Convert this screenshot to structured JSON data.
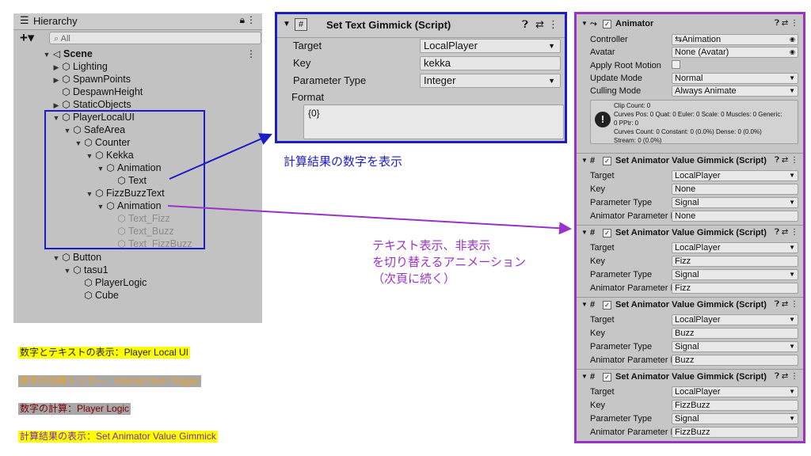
{
  "hierarchy": {
    "title": "Hierarchy",
    "search_placeholder": "All",
    "items": [
      {
        "label": "Scene"
      },
      {
        "label": "Lighting"
      },
      {
        "label": "SpawnPoints"
      },
      {
        "label": "DespawnHeight"
      },
      {
        "label": "StaticObjects"
      },
      {
        "label": "PlayerLocalUI"
      },
      {
        "label": "SafeArea"
      },
      {
        "label": "Counter"
      },
      {
        "label": "Kekka"
      },
      {
        "label": "Animation"
      },
      {
        "label": "Text"
      },
      {
        "label": "FizzBuzzText"
      },
      {
        "label": "Animation"
      },
      {
        "label": "Text_Fizz"
      },
      {
        "label": "Text_Buzz"
      },
      {
        "label": "Text_FizzBuzz"
      },
      {
        "label": "Button"
      },
      {
        "label": "tasu1"
      },
      {
        "label": "PlayerLogic"
      },
      {
        "label": "Cube"
      }
    ]
  },
  "inspector": {
    "title": "Set Text Gimmick (Script)",
    "fields": [
      {
        "label": "Target",
        "value": "LocalPlayer"
      },
      {
        "label": "Key",
        "value": "kekka"
      },
      {
        "label": "Parameter Type",
        "value": "Integer"
      }
    ],
    "format_label": "Format",
    "format_value": "{0}"
  },
  "animator": {
    "title": "Animator",
    "fields": [
      {
        "label": "Controller",
        "value": "Animation"
      },
      {
        "label": "Avatar",
        "value": "None (Avatar)"
      },
      {
        "label": "Apply Root Motion",
        "value": ""
      },
      {
        "label": "Update Mode",
        "value": "Normal"
      },
      {
        "label": "Culling Mode",
        "value": "Always Animate"
      }
    ],
    "info_lines": [
      "Clip Count: 0",
      "Curves Pos: 0 Quat: 0 Euler: 0 Scale: 0 Muscles: 0 Generic:",
      "0 PPtr: 0",
      "Curves Count: 0 Constant: 0 (0.0%) Dense: 0 (0.0%)",
      "Stream: 0 (0.0%)"
    ]
  },
  "gimmicks": [
    {
      "title": "Set Animator Value Gimmick (Script)",
      "target": "LocalPlayer",
      "key": "None",
      "param_type": "Signal",
      "anim_param": "None"
    },
    {
      "title": "Set Animator Value Gimmick (Script)",
      "target": "LocalPlayer",
      "key": "Fizz",
      "param_type": "Signal",
      "anim_param": "Fizz"
    },
    {
      "title": "Set Animator Value Gimmick (Script)",
      "target": "LocalPlayer",
      "key": "Buzz",
      "param_type": "Signal",
      "anim_param": "Buzz"
    },
    {
      "title": "Set Animator Value Gimmick (Script)",
      "target": "LocalPlayer",
      "key": "FizzBuzz",
      "param_type": "Signal",
      "anim_param": "FizzBuzz"
    }
  ],
  "gimmick_labels": {
    "target": "Target",
    "key": "Key",
    "param_type": "Parameter Type",
    "anim_param": "Animator Parameter Name"
  },
  "annotations": {
    "calc_result": "計算結果の数字を表示",
    "toggle_line1": "テキスト表示、非表示",
    "toggle_line2": "を切り替えるアニメーション",
    "toggle_line3": "（次頁に続く）"
  },
  "legend": [
    {
      "text": "数字とテキストの表示：Player Local UI",
      "bg": "#ffff00",
      "color": "#1a1a1a"
    },
    {
      "text": "数字の加算トリガー：Interact Item Trigger",
      "bg": "#a8a8a8",
      "color": "#f0a020"
    },
    {
      "text": "数字の計算：Player Logic",
      "bg": "#a8a8a8",
      "color": "#7a0000"
    },
    {
      "text": "計算結果の表示：Set Animator Value Gimmick",
      "bg": "#ffff00",
      "color": "#7a2ab0"
    }
  ],
  "colors": {
    "blue_box": "#1c1cc8",
    "purple_box": "#9a32c8",
    "calc_text": "#1c1cc8",
    "toggle_text": "#9a32c8"
  }
}
